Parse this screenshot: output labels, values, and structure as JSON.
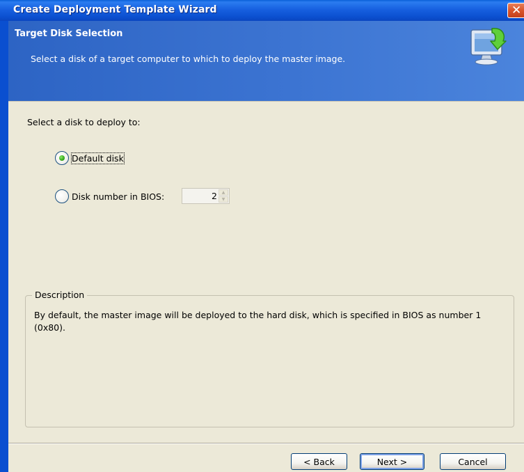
{
  "window": {
    "title": "Create Deployment Template Wizard",
    "close_glyph": "✕"
  },
  "header": {
    "title": "Target Disk Selection",
    "description": "Select a disk of a target computer to which to deploy the master image.",
    "icon": "computer-download-icon"
  },
  "body": {
    "prompt": "Select a disk to deploy to:",
    "options": [
      {
        "label": "Default disk",
        "selected": true
      },
      {
        "label": "Disk number in BIOS:",
        "selected": false
      }
    ],
    "disk_number_value": "2"
  },
  "description_group": {
    "legend": "Description",
    "text": "By default, the master image will be deployed to the hard disk, which is specified in BIOS as number 1 (0x80)."
  },
  "buttons": {
    "back": "< Back",
    "next": "Next >",
    "cancel": "Cancel"
  },
  "colors": {
    "titlebar": "#0b50d0",
    "header_band": "#3c74d2",
    "dialog_bg": "#ece9d8",
    "close_button": "#d9542a",
    "radio_selected": "#3cae22"
  }
}
